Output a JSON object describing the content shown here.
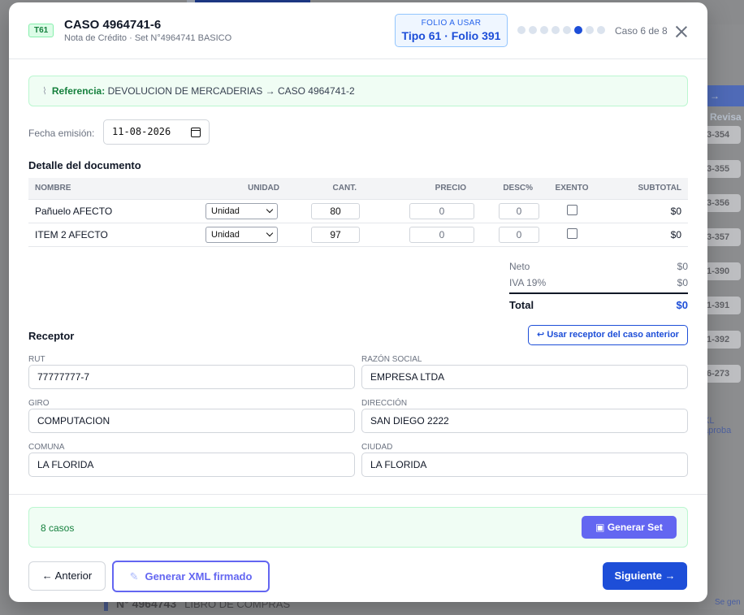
{
  "background": {
    "revisar_label": "→ Revisa",
    "side_chips": [
      "3-354",
      "3-355",
      "3-356",
      "3-357",
      "1-390",
      "1-391",
      "1-392",
      "6-273"
    ],
    "side_note": "XL aproba",
    "bottom_number": "N° 4964743",
    "bottom_label": "LIBRO DE COMPRAS",
    "bottom_note": "Se gen"
  },
  "header": {
    "tipo_badge": "T61",
    "title": "CASO 4964741-6",
    "subtitle": "Nota de Crédito · Set N°4964741 BASICO",
    "folio_label": "FOLIO A USAR",
    "folio_value": "Tipo 61 · Folio 391",
    "progress_text": "Caso 6 de 8",
    "total_cases": 8,
    "current_case": 6
  },
  "referencia": {
    "icon": "paperclip-icon",
    "label": "Referencia:",
    "text": "DEVOLUCION DE MERCADERIAS → CASO 4964741-2"
  },
  "fecha": {
    "label": "Fecha emisión:",
    "value": "11-08-2026"
  },
  "detalle": {
    "title": "Detalle del documento",
    "columns": [
      "NOMBRE",
      "UNIDAD",
      "CANT.",
      "PRECIO",
      "DESC%",
      "EXENTO",
      "SUBTOTAL"
    ],
    "rows": [
      {
        "nombre": "Pañuelo AFECTO",
        "unidad": "Unidad",
        "cantidad": "80",
        "precio": "0",
        "descuento": "0",
        "exento": false,
        "subtotal": "$0"
      },
      {
        "nombre": "ITEM 2 AFECTO",
        "unidad": "Unidad",
        "cantidad": "97",
        "precio": "0",
        "descuento": "0",
        "exento": false,
        "subtotal": "$0"
      }
    ]
  },
  "totales": {
    "neto_label": "Neto",
    "neto": "$0",
    "iva_label": "IVA 19%",
    "iva": "$0",
    "total_label": "Total",
    "total": "$0"
  },
  "receptor": {
    "title": "Receptor",
    "prev_button": "↩ Usar receptor del caso anterior",
    "fields": {
      "rut": {
        "label": "RUT",
        "value": "77777777-7"
      },
      "razon": {
        "label": "RAZÓN SOCIAL",
        "value": "EMPRESA LTDA"
      },
      "giro": {
        "label": "GIRO",
        "value": "COMPUTACION"
      },
      "direccion": {
        "label": "DIRECCIÓN",
        "value": "SAN DIEGO 2222"
      },
      "comuna": {
        "label": "COMUNA",
        "value": "LA FLORIDA"
      },
      "ciudad": {
        "label": "CIUDAD",
        "value": "LA FLORIDA"
      }
    }
  },
  "footer": {
    "casos_text": "8 casos",
    "generar_set": "Generar Set",
    "anterior": "← Anterior",
    "generar_xml": "Generar XML firmado",
    "siguiente": "Siguiente →"
  },
  "colors": {
    "primary": "#1d4ed8",
    "accent_indigo": "#6366f1",
    "success_green": "#15803d",
    "success_bg": "#f0fdf4"
  }
}
